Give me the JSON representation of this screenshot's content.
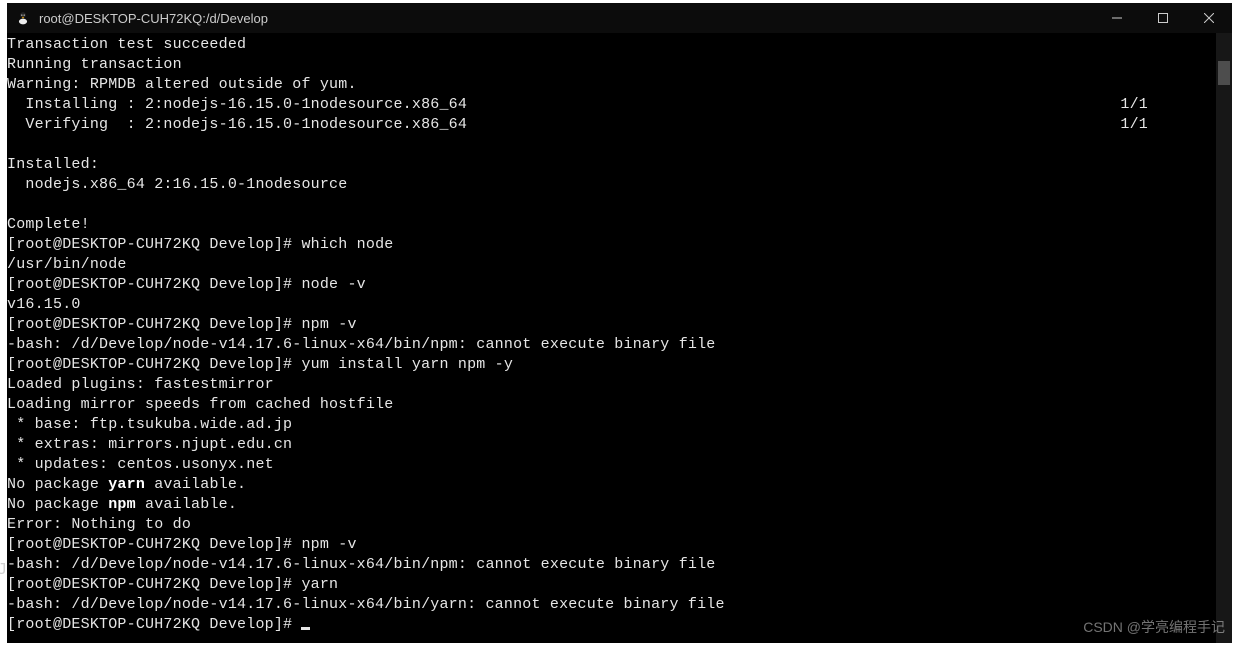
{
  "window": {
    "title": "root@DESKTOP-CUH72KQ:/d/Develop"
  },
  "term": {
    "l1": "Transaction test succeeded",
    "l2": "Running transaction",
    "l3": "Warning: RPMDB altered outside of yum.",
    "l4": "  Installing : 2:nodejs-16.15.0-1nodesource.x86_64                                                                       1/1",
    "l5": "  Verifying  : 2:nodejs-16.15.0-1nodesource.x86_64                                                                       1/1",
    "l6": "",
    "l7": "Installed:",
    "l8": "  nodejs.x86_64 2:16.15.0-1nodesource",
    "l9": "",
    "l10": "Complete!",
    "p1": "[root@DESKTOP-CUH72KQ Develop]# ",
    "c1": "which node",
    "r1": "/usr/bin/node",
    "p2": "[root@DESKTOP-CUH72KQ Develop]# ",
    "c2": "node -v",
    "r2": "v16.15.0",
    "p3": "[root@DESKTOP-CUH72KQ Develop]# ",
    "c3": "npm -v",
    "r3": "-bash: /d/Develop/node-v14.17.6-linux-x64/bin/npm: cannot execute binary file",
    "p4": "[root@DESKTOP-CUH72KQ Develop]# ",
    "c4": "yum install yarn npm -y",
    "r4a": "Loaded plugins: fastestmirror",
    "r4b": "Loading mirror speeds from cached hostfile",
    "r4c": " * base: ftp.tsukuba.wide.ad.jp",
    "r4d": " * extras: mirrors.njupt.edu.cn",
    "r4e": " * updates: centos.usonyx.net",
    "r4f_a": "No package ",
    "r4f_b": "yarn",
    "r4f_c": " available.",
    "r4g_a": "No package ",
    "r4g_b": "npm",
    "r4g_c": " available.",
    "r4h": "Error: Nothing to do",
    "p5": "[root@DESKTOP-CUH72KQ Develop]# ",
    "c5": "npm -v",
    "r5": "-bash: /d/Develop/node-v14.17.6-linux-x64/bin/npm: cannot execute binary file",
    "p6": "[root@DESKTOP-CUH72KQ Develop]# ",
    "c6": "yarn",
    "r6": "-bash: /d/Develop/node-v14.17.6-linux-x64/bin/yarn: cannot execute binary file",
    "p7": "[root@DESKTOP-CUH72KQ Develop]# "
  },
  "watermark": "CSDN @学亮编程手记",
  "edge": "J"
}
